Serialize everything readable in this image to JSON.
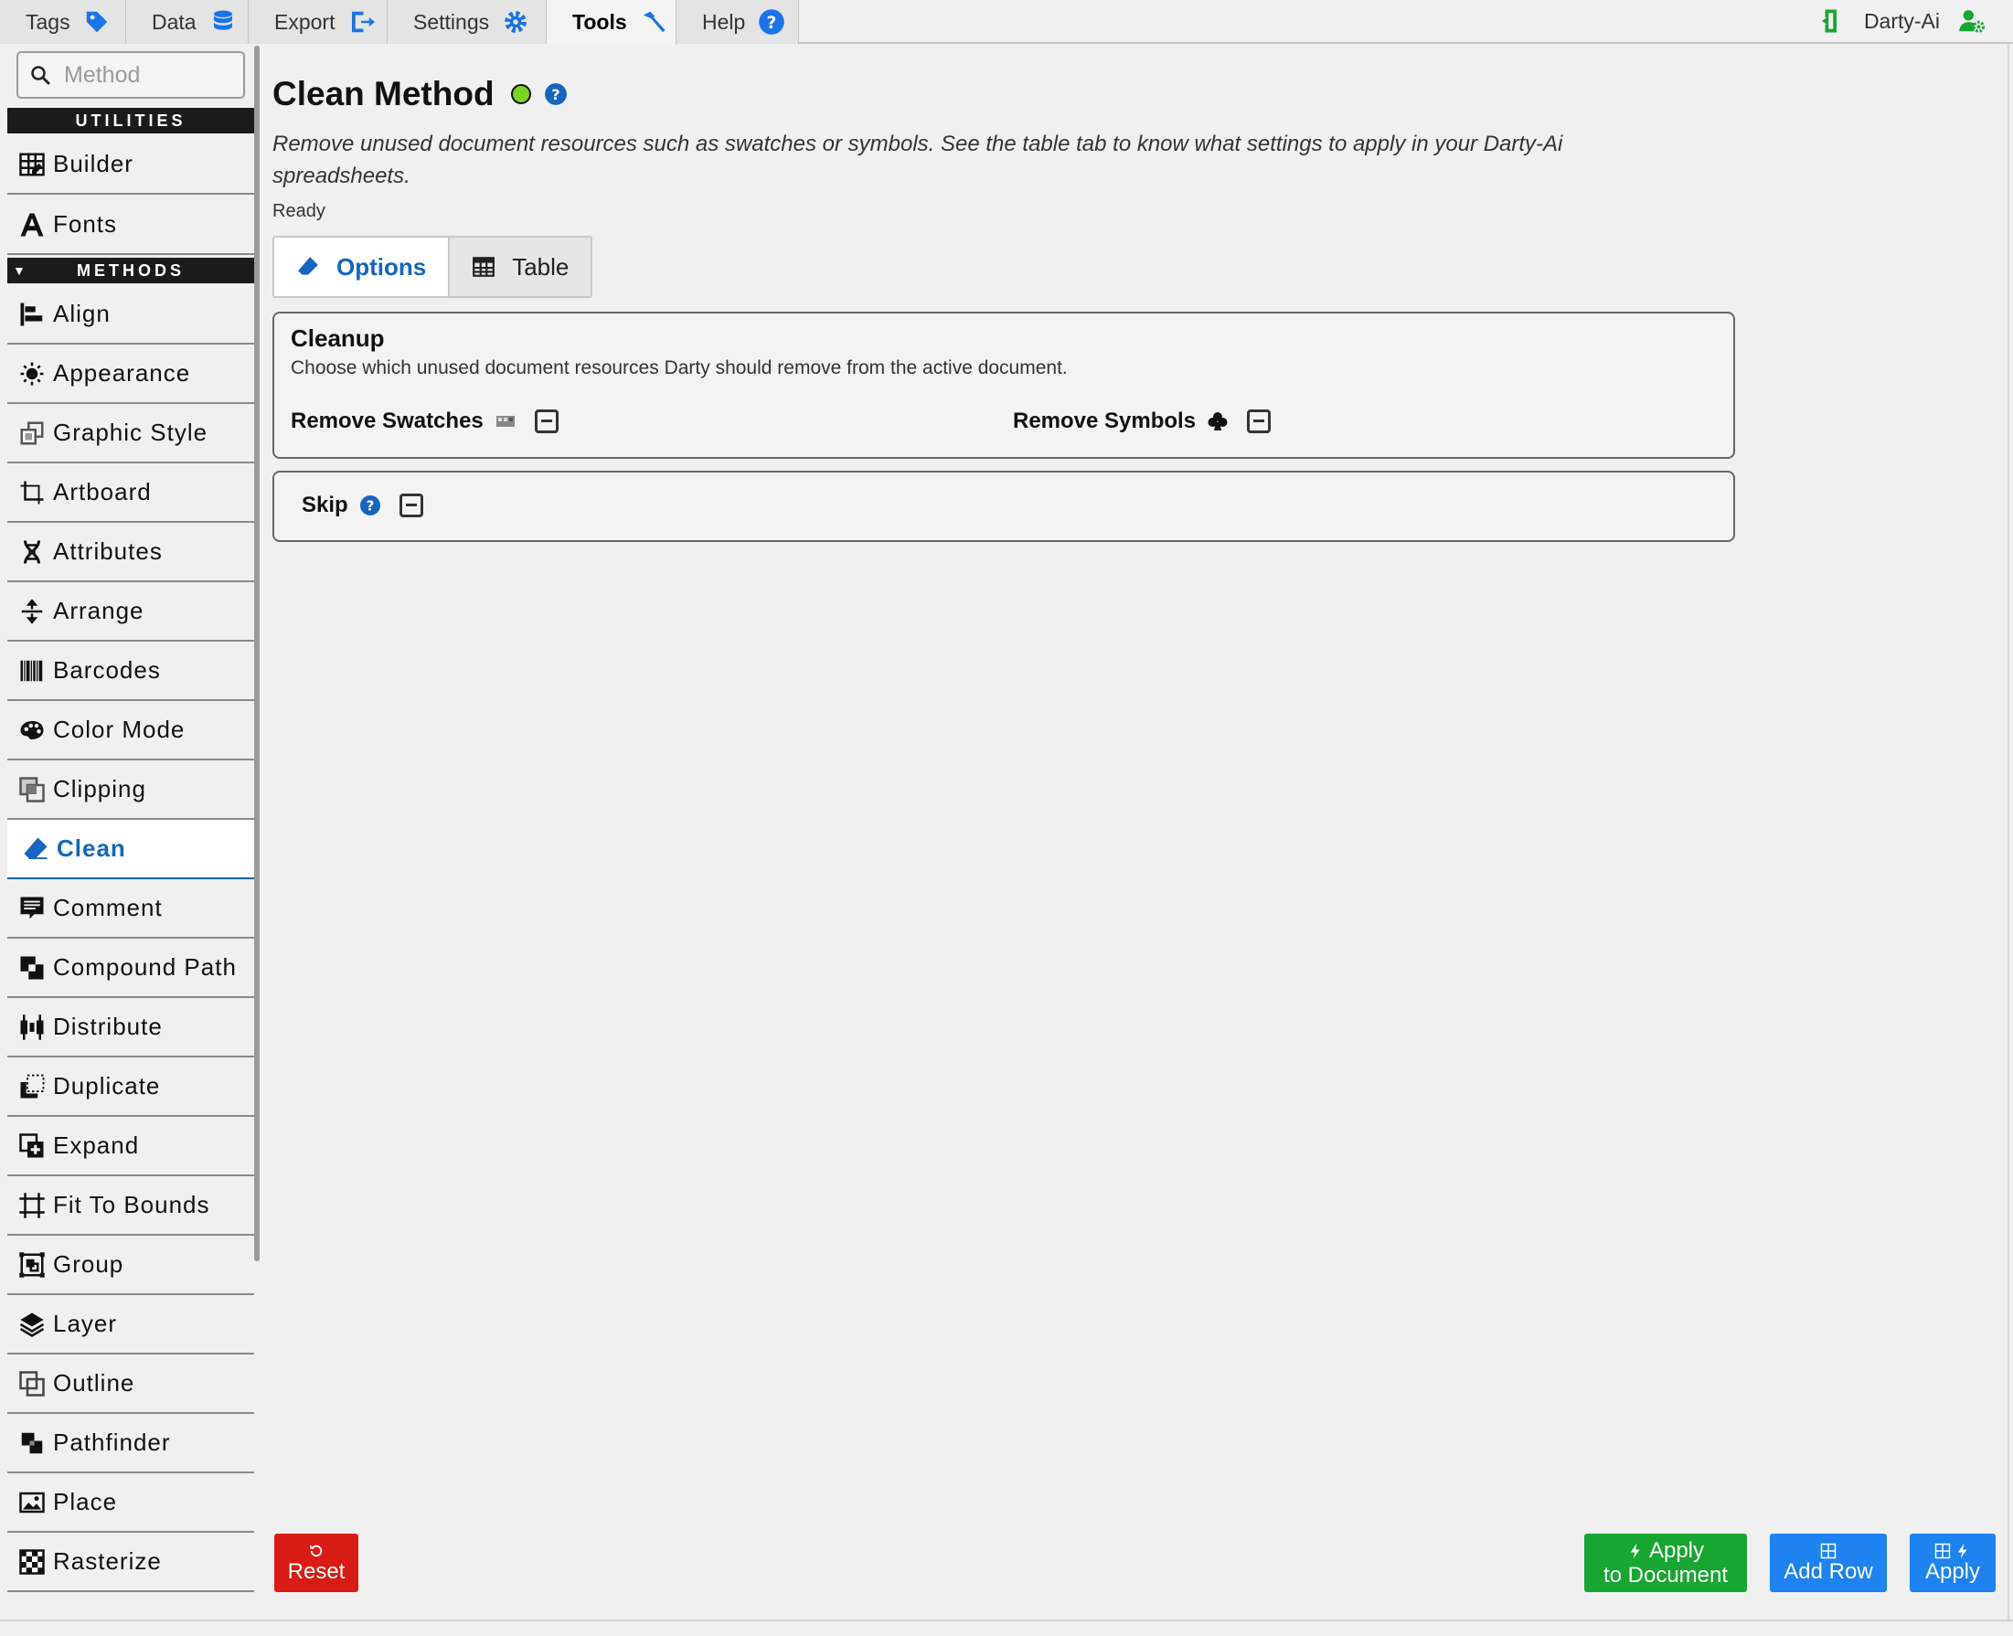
{
  "topbar": {
    "tabs": [
      {
        "label": "Tags",
        "icon": "tag-icon"
      },
      {
        "label": "Data",
        "icon": "database-icon"
      },
      {
        "label": "Export",
        "icon": "export-icon"
      },
      {
        "label": "Settings",
        "icon": "gear-icon"
      },
      {
        "label": "Tools",
        "icon": "hammer-icon",
        "active": true
      },
      {
        "label": "Help",
        "icon": "help-icon"
      }
    ],
    "user": "Darty-Ai"
  },
  "sidebar": {
    "search_placeholder": "Method",
    "utilities_header": "UTILITIES",
    "methods_header": "METHODS",
    "utilities": [
      "Builder",
      "Fonts"
    ],
    "methods": [
      "Align",
      "Appearance",
      "Graphic Style",
      "Artboard",
      "Attributes",
      "Arrange",
      "Barcodes",
      "Color Mode",
      "Clipping",
      "Clean",
      "Comment",
      "Compound Path",
      "Distribute",
      "Duplicate",
      "Expand",
      "Fit To Bounds",
      "Group",
      "Layer",
      "Outline",
      "Pathfinder",
      "Place",
      "Rasterize"
    ],
    "active": "Clean"
  },
  "main": {
    "title": "Clean Method",
    "description": "Remove unused document resources such as swatches or symbols. See the table tab to know what settings to apply in your Darty-Ai spreadsheets.",
    "status": "Ready",
    "tabs": [
      {
        "label": "Options",
        "active": true
      },
      {
        "label": "Table"
      }
    ],
    "cleanup": {
      "title": "Cleanup",
      "description": "Choose which unused document resources Darty should remove from the active document.",
      "swatches_label": "Remove Swatches",
      "symbols_label": "Remove Symbols"
    },
    "skip": {
      "label": "Skip"
    }
  },
  "footer": {
    "reset": "Reset",
    "apply_doc_line1": "Apply",
    "apply_doc_line2": "to Document",
    "add_row": "Add Row",
    "apply": "Apply"
  },
  "colors": {
    "accent": "#1565c0",
    "status_ok": "#7bd321",
    "danger": "#d81b14",
    "success": "#17a631",
    "primary": "#1e82f0"
  }
}
